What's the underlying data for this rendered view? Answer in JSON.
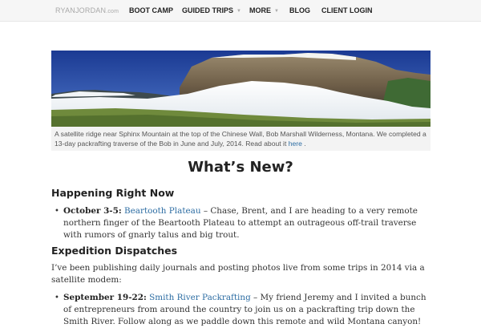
{
  "nav": {
    "brand": "RYANJORDAN",
    "brand_suffix": ".com",
    "items": [
      {
        "label": "BOOT CAMP"
      },
      {
        "label": "GUIDED TRIPS"
      },
      {
        "label": "MORE"
      },
      {
        "label": "BLOG"
      },
      {
        "label": "CLIENT LOGIN"
      }
    ]
  },
  "hero": {
    "caption": "A satellite ridge near Sphinx Mountain at the top of the Chinese Wall, Bob Marshall Wilderness, Montana. We completed a 13-day packrafting traverse of the Bob in June and July, 2014. Read about it",
    "caption_link": "here",
    "caption_end": "."
  },
  "page": {
    "title": "What’s New?"
  },
  "happening": {
    "heading": "Happening Right Now",
    "items": [
      {
        "date": "October 3-5:",
        "link": "Beartooth Plateau",
        "text": " – Chase, Brent, and I are heading to a very remote northern finger of the Beartooth Plateau to attempt an outrageous off-trail traverse with rumors of gnarly talus and big trout."
      }
    ]
  },
  "dispatches": {
    "heading": "Expedition Dispatches",
    "intro": "I’ve been publishing daily journals and posting photos live from some trips in 2014 via a satellite modem:",
    "items": [
      {
        "date": "September 19-22:",
        "link": "Smith River Packrafting",
        "text": " – My friend Jeremy and I invited a bunch of entrepreneurs from around the country to join us on a packrafting trip down the Smith River. Follow along as we paddle down this remote and wild Montana canyon!"
      }
    ]
  },
  "colors": {
    "link": "#2d6da3",
    "nav_bg": "#f6f6f6"
  }
}
